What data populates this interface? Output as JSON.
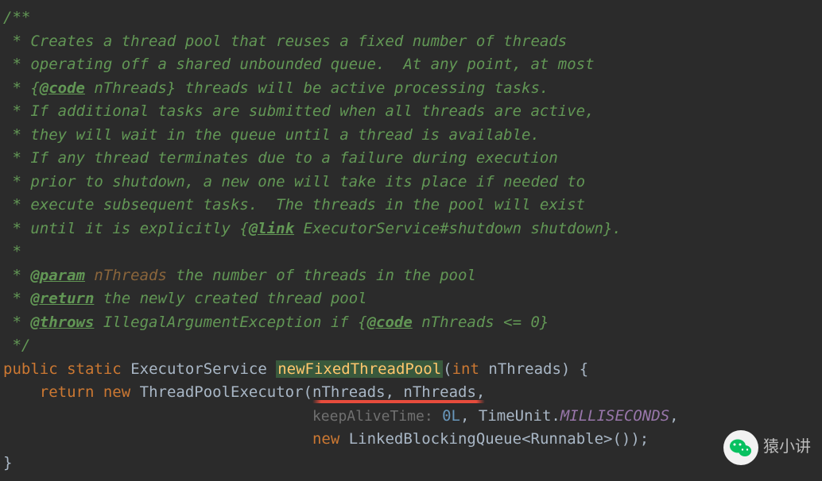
{
  "doc": {
    "open": "/**",
    "l1": " * Creates a thread pool that reuses a fixed number of threads",
    "l2": " * operating off a shared unbounded queue.  At any point, at most",
    "l3a": " * {",
    "l3tag": "@code",
    "l3b": " nThreads} threads will be active processing tasks.",
    "l4": " * If additional tasks are submitted when all threads are active,",
    "l5": " * they will wait in the queue until a thread is available.",
    "l6": " * If any thread terminates due to a failure during execution",
    "l7": " * prior to shutdown, a new one will take its place if needed to",
    "l8": " * execute subsequent tasks.  The threads in the pool will exist",
    "l9a": " * until it is explicitly {",
    "l9tag": "@link",
    "l9b": " ExecutorService#shutdown shutdown}.",
    "l10": " *",
    "l11a": " * ",
    "l11tag": "@param",
    "l11b": " nThreads",
    "l11c": " the number of threads in the pool",
    "l12a": " * ",
    "l12tag": "@return",
    "l12b": " the newly created thread pool",
    "l13a": " * ",
    "l13tag": "@throws",
    "l13b": " IllegalArgumentException if {",
    "l13tag2": "@code",
    "l13c": " nThreads <= 0}",
    "close": " */"
  },
  "code": {
    "kw_public": "public",
    "kw_static": "static",
    "ret_type": "ExecutorService",
    "method": "newFixedThreadPool",
    "param_type": "int",
    "param_name": "nThreads",
    "brace_open": " {",
    "kw_return": "return",
    "kw_new": "new",
    "ctor": "ThreadPoolExecutor",
    "arg1": "nThreads",
    "arg2": "nThreads",
    "hint_keepAlive": "keepAliveTime:",
    "zero": "0L",
    "timeunit_class": "TimeUnit",
    "timeunit_field": "MILLISECONDS",
    "kw_new2": "new",
    "queue_class": "LinkedBlockingQueue",
    "generic_open": "<",
    "runnable": "Runnable",
    "generic_close": ">",
    "parens": "());",
    "brace_close": "}"
  },
  "watermark": "猿小讲"
}
